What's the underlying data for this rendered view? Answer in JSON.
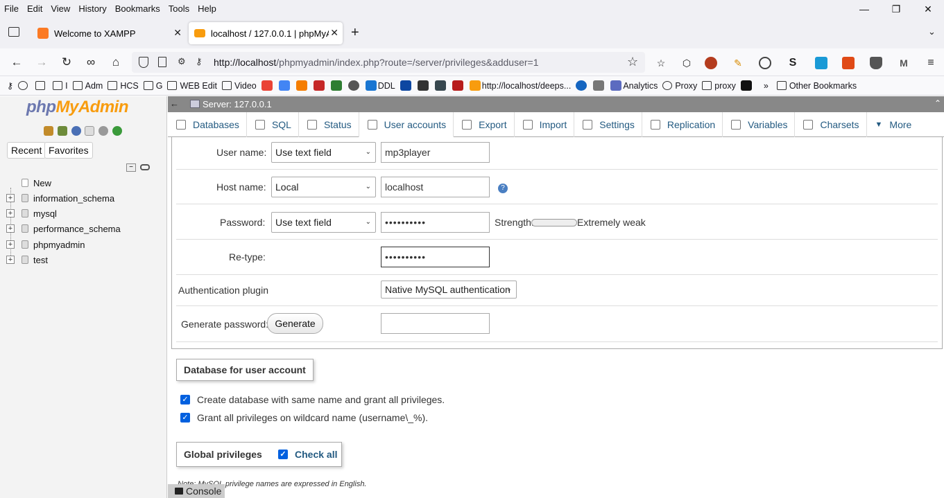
{
  "menu": [
    "File",
    "Edit",
    "View",
    "History",
    "Bookmarks",
    "Tools",
    "Help"
  ],
  "window_controls": {
    "minimize": "—",
    "restore": "❐",
    "close": "✕"
  },
  "tabs": [
    {
      "title": "Welcome to XAMPP",
      "favicon_color": "#fb7a24"
    },
    {
      "title": "localhost / 127.0.0.1 | phpMyAd",
      "favicon_color": "#f89c0e"
    }
  ],
  "url": {
    "host": "http://localhost",
    "path": "/phpmyadmin/index.php?route=/server/privileges&adduser=1"
  },
  "bookmarks": [
    "Adm",
    "HCS",
    "G",
    "WEB Edit",
    "Video",
    "DDL",
    "http://localhost/deeps...",
    "Analytics",
    "Proxy",
    "proxy",
    "Other Bookmarks"
  ],
  "bookmarks_short": [
    "I"
  ],
  "pma": {
    "logo_php": "php",
    "logo_myadmin": "MyAdmin",
    "recent": "Recent",
    "favorites": "Favorites",
    "tree": [
      "New",
      "information_schema",
      "mysql",
      "performance_schema",
      "phpmyadmin",
      "test"
    ],
    "server_bar": "Server: 127.0.0.1",
    "tabs": [
      "Databases",
      "SQL",
      "Status",
      "User accounts",
      "Export",
      "Import",
      "Settings",
      "Replication",
      "Variables",
      "Charsets",
      "More"
    ],
    "active_tab": "User accounts"
  },
  "form": {
    "user_name_label": "User name:",
    "user_name_select": "Use text field",
    "user_name_value": "mp3player",
    "host_name_label": "Host name:",
    "host_name_select": "Local",
    "host_name_value": "localhost",
    "password_label": "Password:",
    "password_select": "Use text field",
    "password_value": "••••••••••",
    "strength_label": "Strength:",
    "strength_text": "Extremely weak",
    "retype_label": "Re-type:",
    "retype_value": "••••••••••",
    "auth_label": "Authentication plugin",
    "auth_select": "Native MySQL authentication",
    "genpass_label": "Generate password:",
    "generate_button": "Generate"
  },
  "db_section": {
    "legend": "Database for user account",
    "opt1": "Create database with same name and grant all privileges.",
    "opt2": "Grant all privileges on wildcard name (username\\_%)."
  },
  "global": {
    "legend": "Global privileges",
    "check_all": "Check all",
    "note": "Note: MySQL privilege names are expressed in English."
  },
  "console": "Console"
}
